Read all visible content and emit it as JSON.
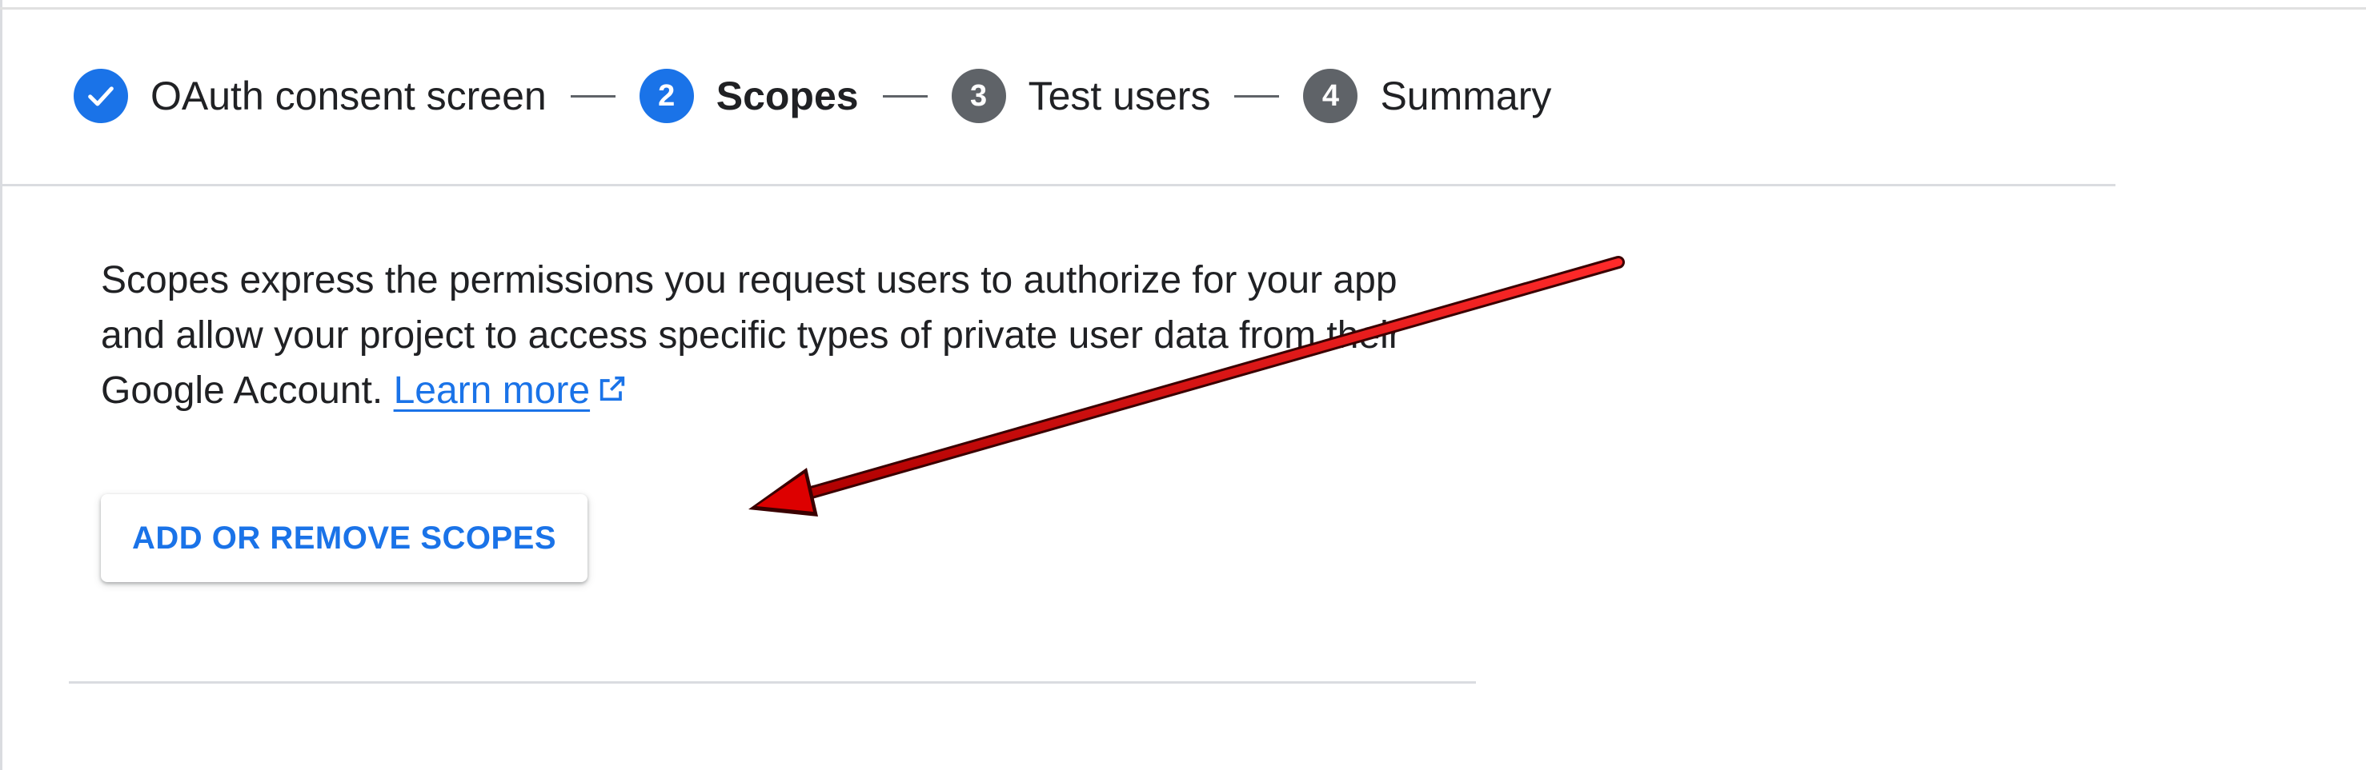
{
  "stepper": {
    "steps": [
      {
        "number": "",
        "label": "OAuth consent screen",
        "state": "done"
      },
      {
        "number": "2",
        "label": "Scopes",
        "state": "active"
      },
      {
        "number": "3",
        "label": "Test users",
        "state": "pending"
      },
      {
        "number": "4",
        "label": "Summary",
        "state": "pending"
      }
    ]
  },
  "scopes": {
    "description": "Scopes express the permissions you request users to authorize for your app and allow your project to access specific types of private user data from their Google Account.",
    "learn_more": "Learn more",
    "add_button_label": "ADD OR REMOVE SCOPES"
  },
  "annotation": {
    "arrow_color": "#e00000"
  },
  "colors": {
    "accent": "#1a73e8",
    "pending_step": "#5f6368",
    "divider": "#dadce0"
  }
}
